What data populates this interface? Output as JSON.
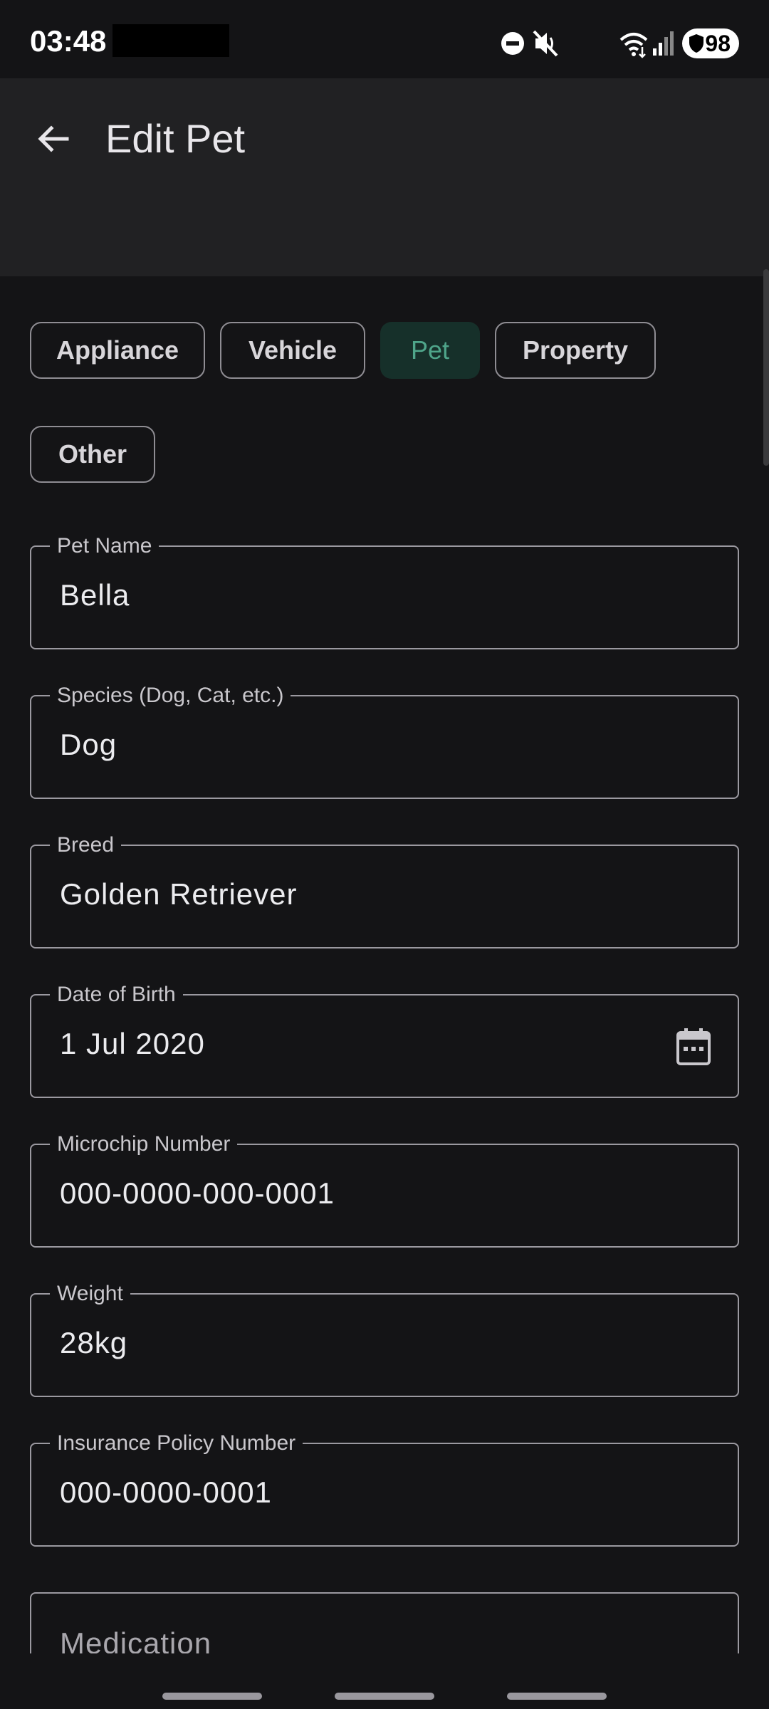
{
  "status_bar": {
    "time": "03:48",
    "battery": "98",
    "icons": [
      "dnd-icon",
      "mute-icon",
      "wifi-icon",
      "signal-icon",
      "shield-icon"
    ]
  },
  "app_bar": {
    "title": "Edit Pet",
    "back_icon": "arrow-back-icon"
  },
  "categories": {
    "items": [
      "Appliance",
      "Vehicle",
      "Pet",
      "Property",
      "Other"
    ],
    "selected": "Pet"
  },
  "fields": {
    "pet_name": {
      "label": "Pet Name",
      "value": "Bella"
    },
    "species": {
      "label": "Species (Dog, Cat, etc.)",
      "value": "Dog"
    },
    "breed": {
      "label": "Breed",
      "value": "Golden Retriever"
    },
    "dob": {
      "label": "Date of Birth",
      "value": "1 Jul 2020",
      "icon": "calendar-icon"
    },
    "microchip": {
      "label": "Microchip Number",
      "value": "000-0000-000-0001"
    },
    "weight": {
      "label": "Weight",
      "value": "28kg"
    },
    "insurance": {
      "label": "Insurance Policy Number",
      "value": "000-0000-0001"
    },
    "medication": {
      "placeholder": "Medication"
    }
  },
  "colors": {
    "background": "#141416",
    "app_bar": "#212123",
    "selected_chip_bg": "#16302a",
    "selected_chip_text": "#4fa58a",
    "outline": "#9b99a0"
  }
}
